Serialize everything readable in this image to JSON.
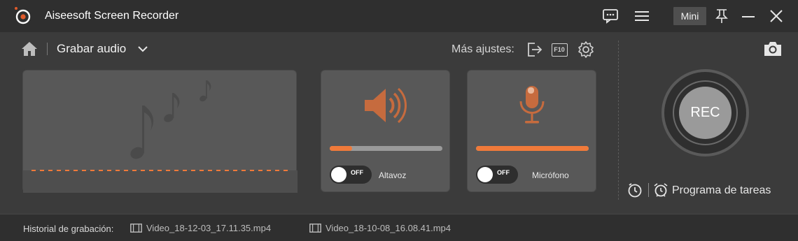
{
  "window": {
    "title": "Aiseesoft Screen Recorder",
    "mini_label": "Mini"
  },
  "toolbar": {
    "mode_label": "Grabar audio",
    "more_settings_label": "Más ajustes:",
    "fps_icon_text": "F10"
  },
  "speaker": {
    "label": "Altavoz",
    "toggle_state": "OFF",
    "volume_fraction": 0.2
  },
  "mic": {
    "label": "Micrófono",
    "toggle_state": "OFF",
    "volume_fraction": 1.0
  },
  "record": {
    "button_label": "REC",
    "schedule_label": "Programa de tareas"
  },
  "history": {
    "label": "Historial de grabación:",
    "files": [
      "Video_18-12-03_17.11.35.mp4",
      "Video_18-10-08_16.08.41.mp4"
    ]
  },
  "colors": {
    "accent": "#f07a3a",
    "panel": "#585858",
    "titlebar": "#2f2f2f"
  }
}
